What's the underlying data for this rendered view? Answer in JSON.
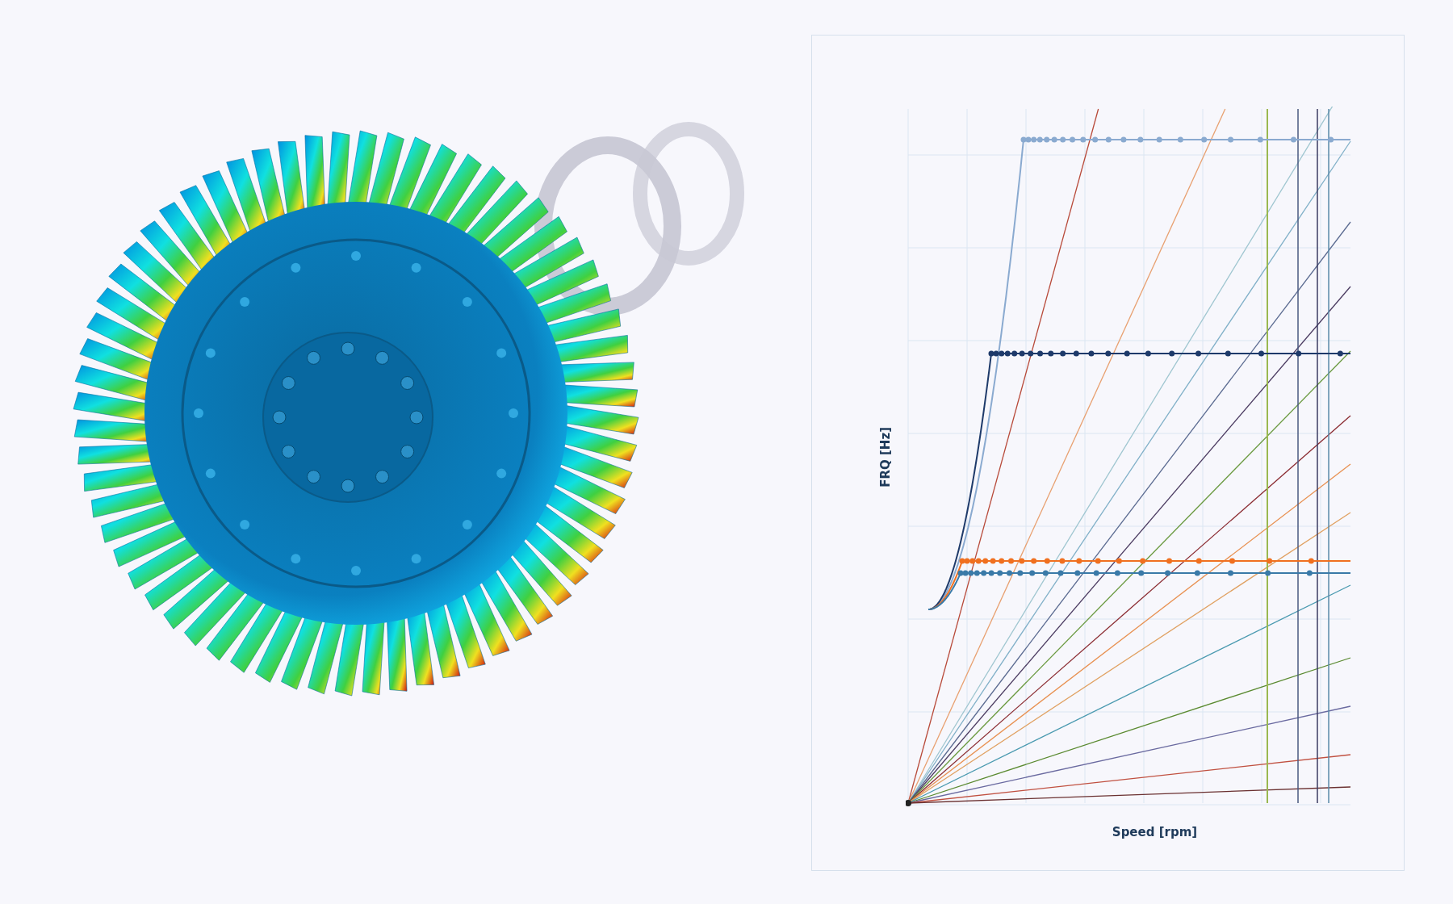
{
  "chart": {
    "ylabel": "FRQ [Hz]",
    "xlabel": "Speed [rpm]"
  }
}
